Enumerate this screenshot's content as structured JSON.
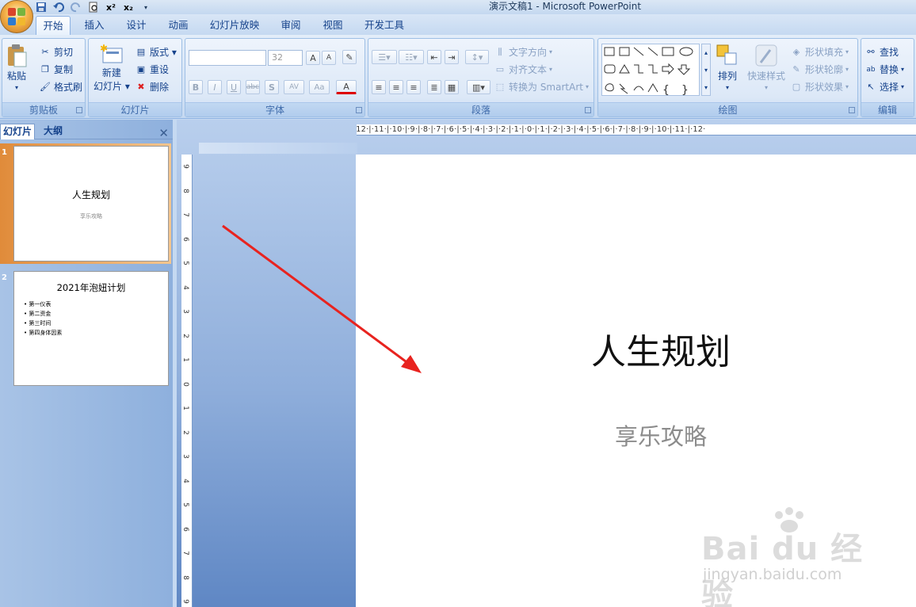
{
  "window": {
    "title": "演示文稿1 - Microsoft PowerPoint"
  },
  "qat": [
    "save-icon",
    "undo-icon",
    "redo-icon",
    "print-preview-icon",
    "superscript-icon",
    "subscript-icon",
    "customize-icon"
  ],
  "qat_text": {
    "sup": "x²",
    "sub": "x₂"
  },
  "tabs": [
    "开始",
    "插入",
    "设计",
    "动画",
    "幻灯片放映",
    "审阅",
    "视图",
    "开发工具"
  ],
  "ribbon": {
    "clipboard": {
      "label": "剪贴板",
      "paste": "粘贴",
      "cut": "剪切",
      "copy": "复制",
      "format_painter": "格式刷"
    },
    "slides": {
      "label": "幻灯片",
      "new_slide_line1": "新建",
      "new_slide_line2": "幻灯片 ▾",
      "layout": "版式 ▾",
      "reset": "重设",
      "delete": "删除"
    },
    "font": {
      "label": "字体",
      "font_name": "",
      "font_size": "32",
      "bold": "B",
      "italic": "I",
      "underline": "U",
      "strike": "abc",
      "shadow": "S",
      "spacing": "AV",
      "case": "Aa",
      "color": "A",
      "grow": "A",
      "shrink": "A"
    },
    "paragraph": {
      "label": "段落",
      "text_direction": "文字方向",
      "align_text": "对齐文本",
      "convert_smartart": "转换为 SmartArt"
    },
    "drawing": {
      "label": "绘图",
      "arrange": "排列",
      "quick_styles": "快速样式",
      "shape_fill": "形状填充",
      "shape_outline": "形状轮廓",
      "shape_effects": "形状效果"
    },
    "editing": {
      "label": "编辑",
      "find": "查找",
      "replace": "替换",
      "select": "选择"
    }
  },
  "panel": {
    "tab_slides": "幻灯片",
    "tab_outline": "大纲",
    "close": "✕"
  },
  "thumbnails": [
    {
      "number": "1",
      "title": "人生规划",
      "subtitle": "享乐攻略"
    },
    {
      "number": "2",
      "title": "2021年泡妞计划",
      "bullets": [
        "第一仪表",
        "第二资金",
        "第三时间",
        "第四身体因素"
      ]
    }
  ],
  "slide": {
    "title": "人生规划",
    "subtitle": "享乐攻略"
  },
  "ruler": {
    "horizontal": "·12·|·11·|·10·|·9·|·8·|·7·|·6·|·5·|·4·|·3·|·2·|·1·|·0·|·1·|·2·|·3·|·4·|·5·|·6·|·7·|·8·|·9·|·10·|·11·|·12·",
    "vertical": [
      "9",
      "8",
      "7",
      "6",
      "5",
      "4",
      "3",
      "2",
      "1",
      "0",
      "1",
      "2",
      "3",
      "4",
      "5",
      "6",
      "7",
      "8",
      "9"
    ]
  },
  "watermark": {
    "brand": "Bai du 经验",
    "url": "jingyan.baidu.com"
  },
  "colors": {
    "ribbon_text": "#15428b",
    "annotation_arrow": "#e8231f",
    "selected_thumb": "#e08b3a"
  }
}
